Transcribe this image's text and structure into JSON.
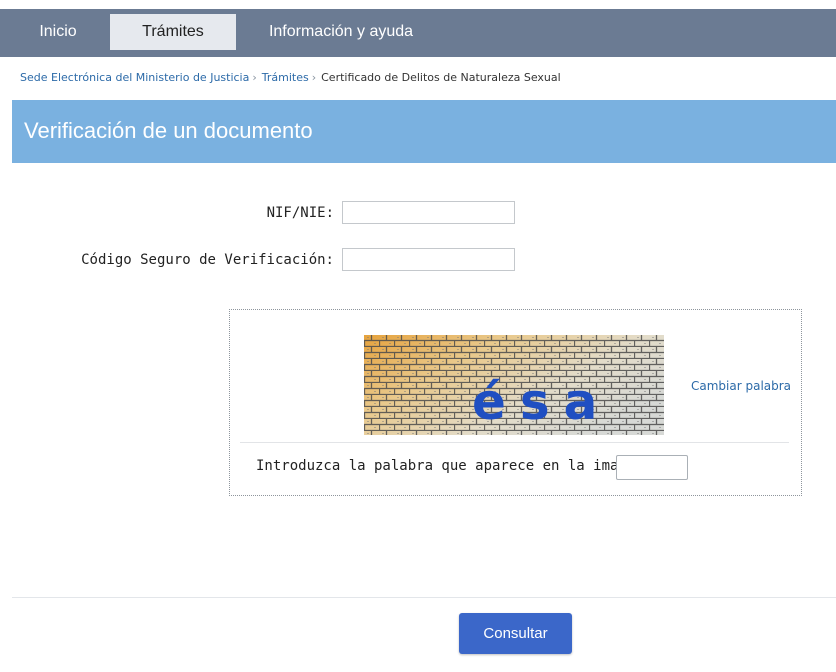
{
  "nav": {
    "items": [
      {
        "label": "Inicio"
      },
      {
        "label": "Trámites"
      },
      {
        "label": "Información y ayuda"
      }
    ],
    "active": "Trámites"
  },
  "breadcrumb": {
    "items": [
      {
        "label": "Sede Electrónica del Ministerio de Justicia",
        "link": true
      },
      {
        "label": "Trámites",
        "link": true
      },
      {
        "label": "Certificado de Delitos de Naturaleza Sexual",
        "link": false
      }
    ],
    "separator": "›"
  },
  "page": {
    "title": "Verificación de un documento"
  },
  "form": {
    "nif_label": "NIF/NIE:",
    "nif_value": "",
    "csv_label": "Código Seguro de Verificación:",
    "csv_value": ""
  },
  "captcha": {
    "word": "ésa",
    "change_label": "Cambiar palabra",
    "prompt": "Introduzca la palabra que aparece en la imagen:",
    "value": ""
  },
  "actions": {
    "submit_label": "Consultar"
  },
  "colors": {
    "topbar": "#6b7b93",
    "title_band": "#7ab1e0",
    "link": "#2c6aa8",
    "button": "#3b67c9",
    "captcha_text": "#1f4fc2"
  }
}
